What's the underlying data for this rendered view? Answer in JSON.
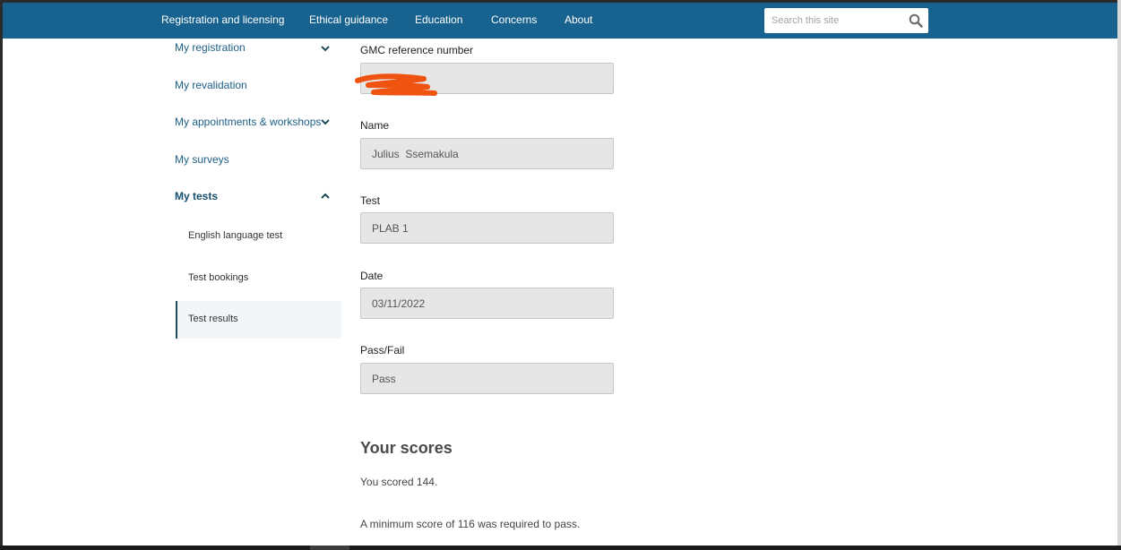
{
  "topnav": {
    "items": [
      "Registration and licensing",
      "Ethical guidance",
      "Education",
      "Concerns",
      "About"
    ],
    "search_placeholder": "Search this site"
  },
  "sidebar": {
    "items": [
      "My registration",
      "My revalidation",
      "My appointments & workshops",
      "My surveys",
      "My tests"
    ],
    "sub_items": [
      "English language test",
      "Test bookings",
      "Test results"
    ],
    "active_sub_item": "Test results"
  },
  "form": {
    "gmc_label": "GMC reference number",
    "gmc_value": "",
    "name_label": "Name",
    "name_value": "Julius  Ssemakula",
    "test_label": "Test",
    "test_value": "PLAB 1",
    "date_label": "Date",
    "date_value": "03/11/2022",
    "passfail_label": "Pass/Fail",
    "passfail_value": "Pass"
  },
  "scores": {
    "heading": "Your scores",
    "scored_text": "You scored 144.",
    "minimum_text": "A minimum score of 116 was required to pass."
  },
  "colors": {
    "nav_background": "#17628e",
    "sidebar_link": "#1d5f86",
    "redaction": "#f0530f"
  }
}
